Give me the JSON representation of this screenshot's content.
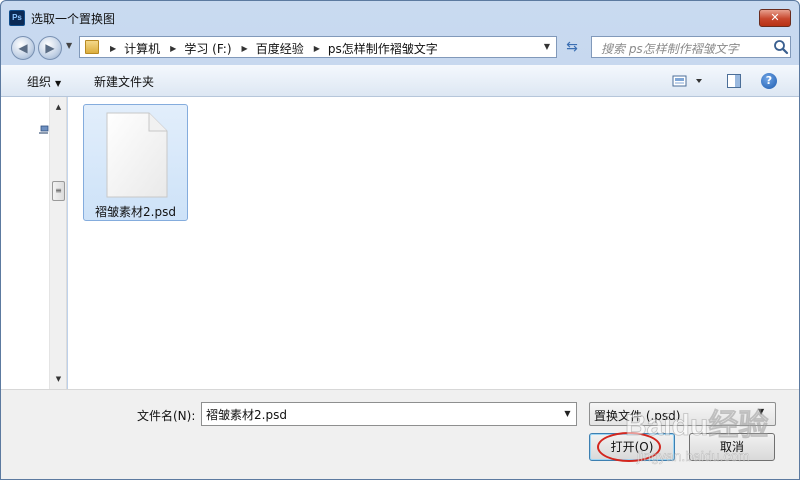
{
  "window": {
    "title": "选取一个置换图",
    "app_icon_text": "Ps",
    "close_symbol": "✕"
  },
  "navigation": {
    "back_symbol": "◀",
    "forward_symbol": "▶",
    "breadcrumbs": [
      "计算机",
      "学习 (F:)",
      "百度经验",
      "ps怎样制作褶皱文字"
    ],
    "refresh_symbol": "⇆",
    "search_placeholder": "搜索 ps怎样制作褶皱文字"
  },
  "toolbar": {
    "organize_label": "组织",
    "new_folder_label": "新建文件夹",
    "help_symbol": "?"
  },
  "files": [
    {
      "name": "褶皱素材2.psd",
      "selected": true
    }
  ],
  "bottom": {
    "filename_label": "文件名(N):",
    "filename_value": "褶皱素材2.psd",
    "filetype_value": "置换文件 (.psd)",
    "open_label": "打开(O)",
    "cancel_label": "取消"
  },
  "watermark": {
    "text": "Baidu经验",
    "subtext": "jingyan.baidu.com"
  },
  "colors": {
    "accent": "#3c7fb1",
    "highlight_oval": "#d3261e",
    "selection": "#cde2f8"
  }
}
